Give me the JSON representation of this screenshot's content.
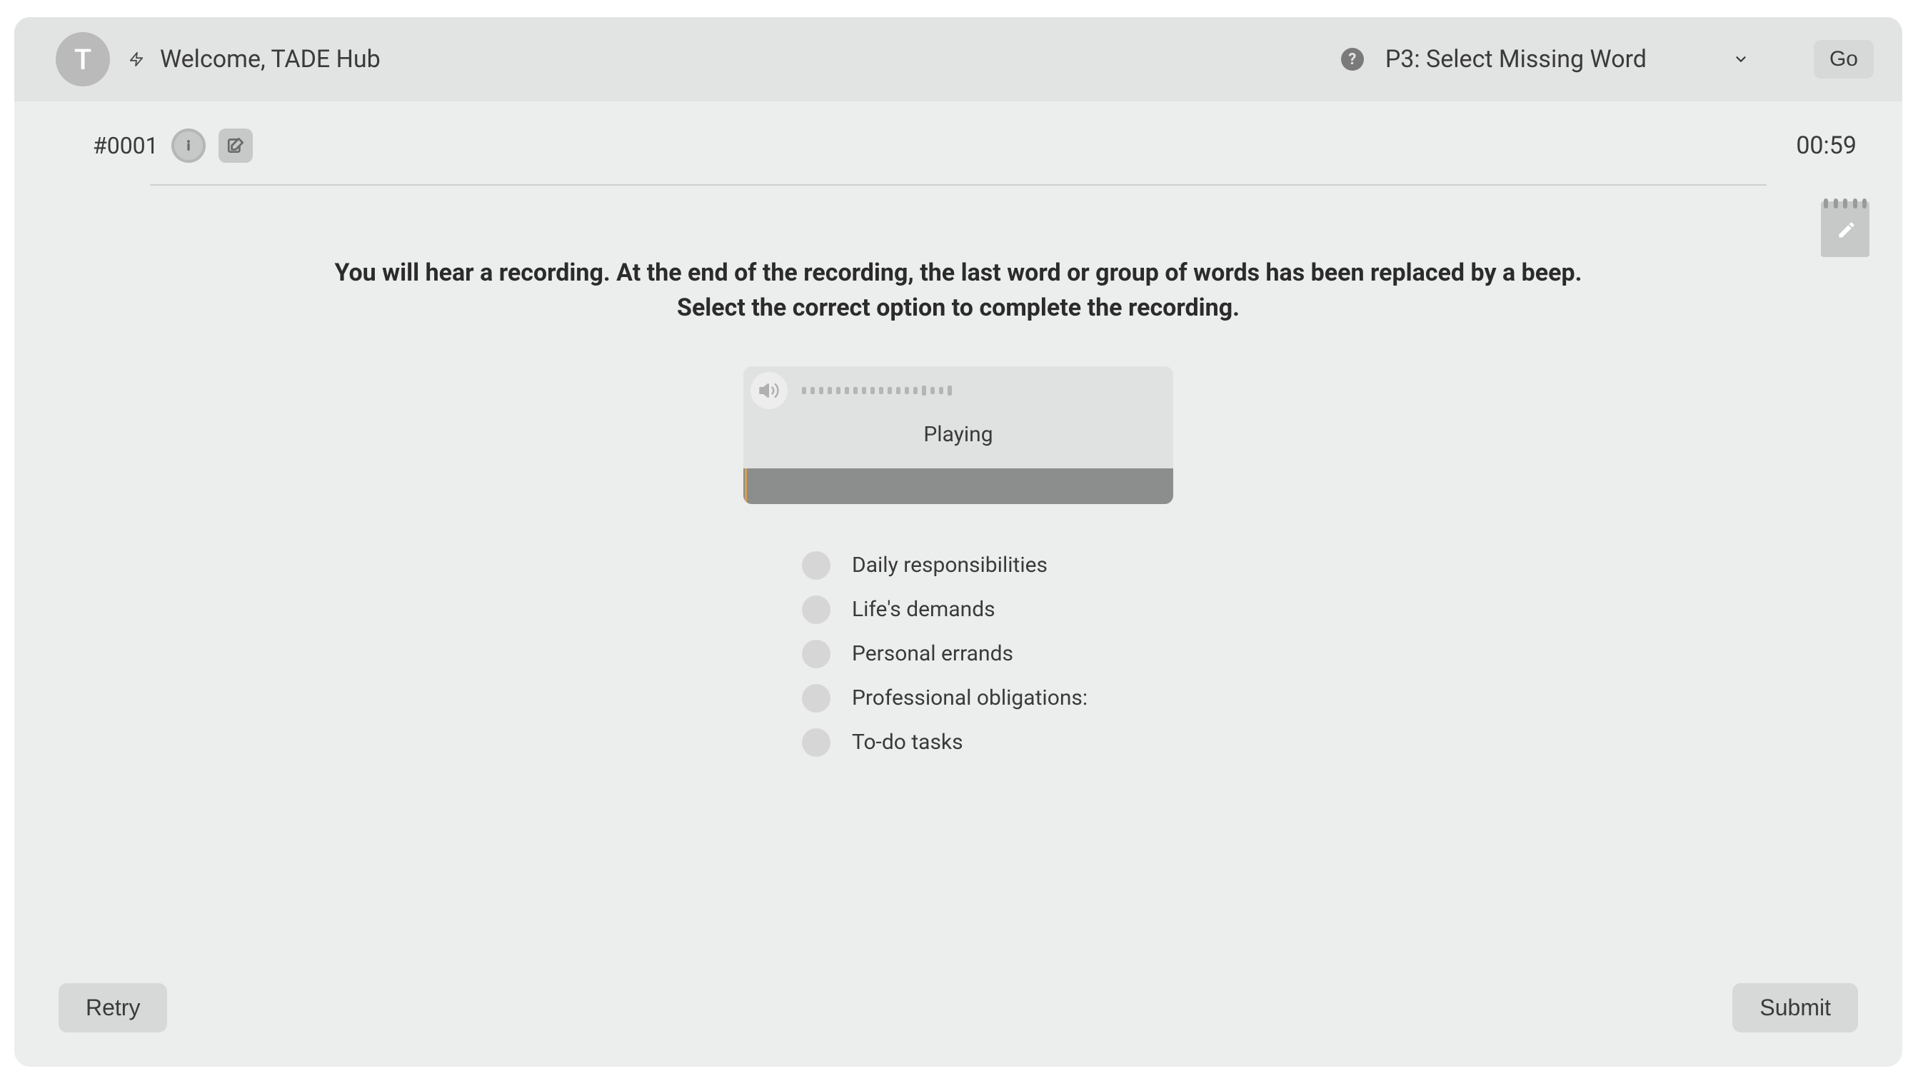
{
  "header": {
    "avatar_initial": "T",
    "welcome": "Welcome, TADE Hub",
    "dropdown_label": "P3: Select Missing Word",
    "go_label": "Go"
  },
  "subbar": {
    "question_id": "#0001",
    "timer": "00:59"
  },
  "prompt": {
    "line1": "You will hear a recording. At the end of the recording, the last word or group of words has been replaced by a beep.",
    "line2": "Select the correct option to complete the recording."
  },
  "audio": {
    "status": "Playing"
  },
  "options": [
    "Daily responsibilities",
    "Life's demands",
    "Personal errands",
    "Professional obligations:",
    "To-do tasks"
  ],
  "footer": {
    "retry": "Retry",
    "submit": "Submit"
  }
}
